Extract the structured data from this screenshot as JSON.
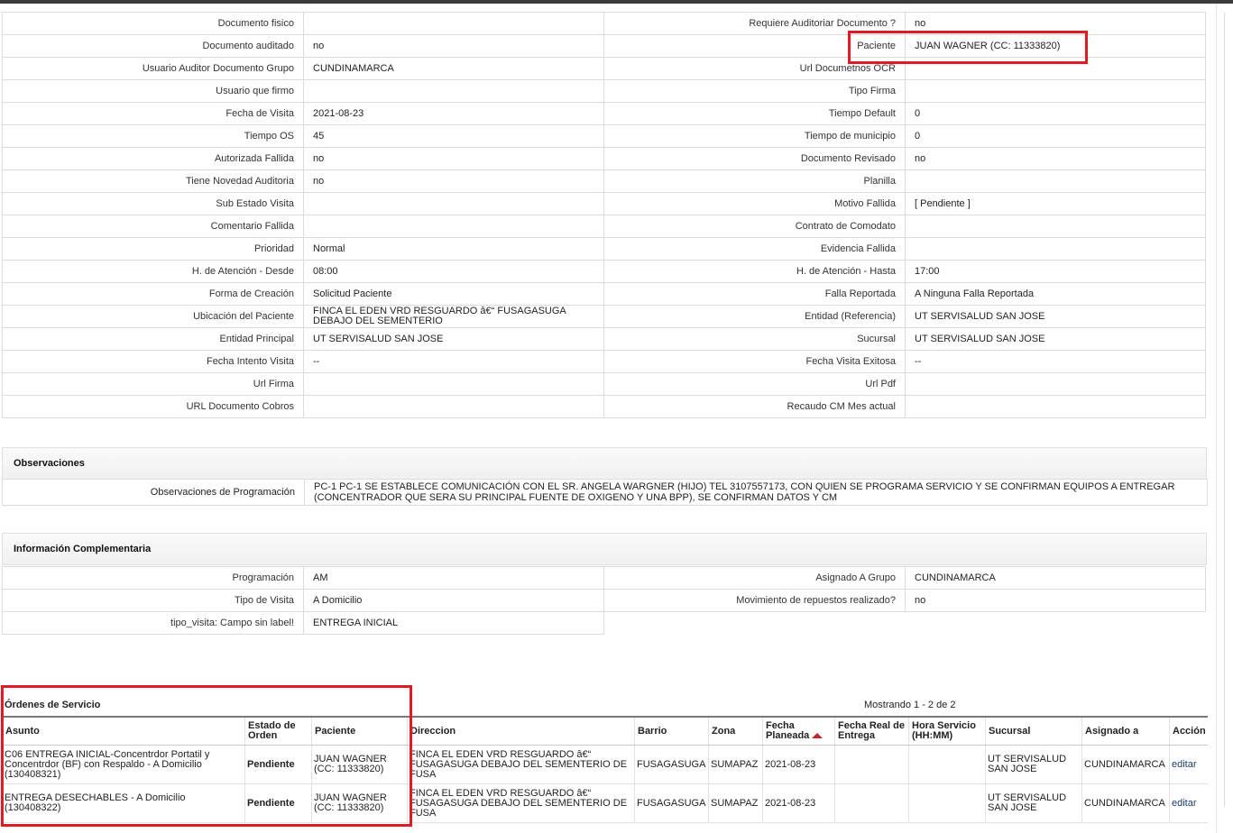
{
  "details": [
    {
      "l1": "Documento fisico",
      "v1": "",
      "l2": "Requiere Auditoriar Documento ?",
      "v2": "no"
    },
    {
      "l1": "Documento auditado",
      "v1": "no",
      "l2": "Paciente",
      "v2": "JUAN WAGNER (CC: 11333820)"
    },
    {
      "l1": "Usuario Auditor Documento Grupo",
      "v1": "CUNDINAMARCA",
      "l2": "Url Documetnos OCR",
      "v2": ""
    },
    {
      "l1": "Usuario que firmo",
      "v1": "",
      "l2": "Tipo Firma",
      "v2": ""
    },
    {
      "l1": "Fecha de Visita",
      "v1": "2021-08-23",
      "l2": "Tiempo Default",
      "v2": "0"
    },
    {
      "l1": "Tiempo OS",
      "v1": "45",
      "l2": "Tiempo de municipio",
      "v2": "0"
    },
    {
      "l1": "Autorizada Fallida",
      "v1": "no",
      "l2": "Documento Revisado",
      "v2": "no"
    },
    {
      "l1": "Tiene Novedad Auditoria",
      "v1": "no",
      "l2": "Planilla",
      "v2": ""
    },
    {
      "l1": "Sub Estado Visita",
      "v1": "",
      "l2": "Motivo Fallida",
      "v2": "[ Pendiente ]"
    },
    {
      "l1": "Comentario Fallida",
      "v1": "",
      "l2": "Contrato de Comodato",
      "v2": ""
    },
    {
      "l1": "Prioridad",
      "v1": "Normal",
      "l2": "Evidencia Fallida",
      "v2": ""
    },
    {
      "l1": "H. de Atención - Desde",
      "v1": "08:00",
      "l2": "H. de Atención - Hasta",
      "v2": "17:00"
    },
    {
      "l1": "Forma de Creación",
      "v1": "Solicitud Paciente",
      "l2": "Falla Reportada",
      "v2": "A Ninguna Falla Reportada"
    },
    {
      "l1": "Ubicación del Paciente",
      "v1": "FINCA EL EDEN VRD RESGUARDO â€“ FUSAGASUGA DEBAJO DEL SEMENTERIO",
      "l2": "Entidad (Referencia)",
      "v2": "UT SERVISALUD SAN JOSE"
    },
    {
      "l1": "Entidad Principal",
      "v1": "UT SERVISALUD SAN JOSE",
      "l2": "Sucursal",
      "v2": "UT SERVISALUD SAN JOSE"
    },
    {
      "l1": "Fecha Intento Visita",
      "v1": "--",
      "l2": "Fecha Visita Exitosa",
      "v2": "--"
    },
    {
      "l1": "Url Firma",
      "v1": "",
      "l2": "Url Pdf",
      "v2": ""
    },
    {
      "l1": "URL Documento Cobros",
      "v1": "",
      "l2": "Recaudo CM Mes actual",
      "v2": ""
    }
  ],
  "observaciones": {
    "title": "Observaciones",
    "label": "Observaciones de Programación",
    "text": "PC-1 PC-1 SE ESTABLECE COMUNICACIÓN CON EL SR. ANGELA WARGNER (HIJO) TEL 3107557173, CON QUIEN SE PROGRAMA SERVICIO Y SE CONFIRMAN EQUIPOS A ENTREGAR (CONCENTRADOR QUE SERA SU PRINCIPAL FUENTE DE OXIGENO Y UNA BPP), SE CONFIRMAN DATOS Y CM"
  },
  "complementaria": {
    "title": "Información Complementaria",
    "rows": [
      {
        "l1": "Programación",
        "v1": "AM",
        "l2": "Asignado A Grupo",
        "v2": "CUNDINAMARCA"
      },
      {
        "l1": "Tipo de Visita",
        "v1": "A Domicilio",
        "l2": "Movimiento de repuestos realizado?",
        "v2": "no"
      },
      {
        "l1": "tipo_visita: Campo sin label!",
        "v1": "ENTREGA INICIAL",
        "l2": "",
        "v2": ""
      }
    ]
  },
  "ordenes": {
    "title": "Órdenes de Servicio",
    "count": "Mostrando 1 - 2 de 2",
    "headers": {
      "asunto": "Asunto",
      "estado": "Estado de Orden",
      "paciente": "Paciente",
      "direccion": "Direccion",
      "barrio": "Barrio",
      "zona": "Zona",
      "fecha_planeada": "Fecha Planeada",
      "fecha_real": "Fecha Real de Entrega",
      "hora": "Hora Servicio (HH:MM)",
      "sucursal": "Sucursal",
      "asignado": "Asignado a",
      "accion": "Acción"
    },
    "rows": [
      {
        "asunto": "C06 ENTREGA INICIAL-Concentrdor Portatil y Concentrdor (BF) con Respaldo - A Domicilio (130408321)",
        "estado": "Pendiente",
        "paciente": "JUAN WAGNER (CC: 11333820)",
        "direccion": "FINCA EL EDEN VRD RESGUARDO â€“ FUSAGASUGA DEBAJO DEL SEMENTERIO DE FUSA",
        "barrio": "FUSAGASUGA",
        "zona": "SUMAPAZ",
        "fecha_planeada": "2021-08-23",
        "fecha_real": "",
        "hora": "",
        "sucursal": "UT SERVISALUD SAN JOSE",
        "asignado": "CUNDINAMARCA",
        "accion": "editar"
      },
      {
        "asunto": "ENTREGA DESECHABLES - A Domicilio (130408322)",
        "estado": "Pendiente",
        "paciente": "JUAN WAGNER (CC: 11333820)",
        "direccion": "FINCA EL EDEN VRD RESGUARDO â€“ FUSAGASUGA DEBAJO DEL SEMENTERIO DE FUSA",
        "barrio": "FUSAGASUGA",
        "zona": "SUMAPAZ",
        "fecha_planeada": "2021-08-23",
        "fecha_real": "",
        "hora": "",
        "sucursal": "UT SERVISALUD SAN JOSE",
        "asignado": "CUNDINAMARCA",
        "accion": "editar"
      }
    ]
  },
  "colors": {
    "highlight": "#e01b22",
    "sort_arrow": "#c0272d",
    "border": "#dcdcdc"
  }
}
